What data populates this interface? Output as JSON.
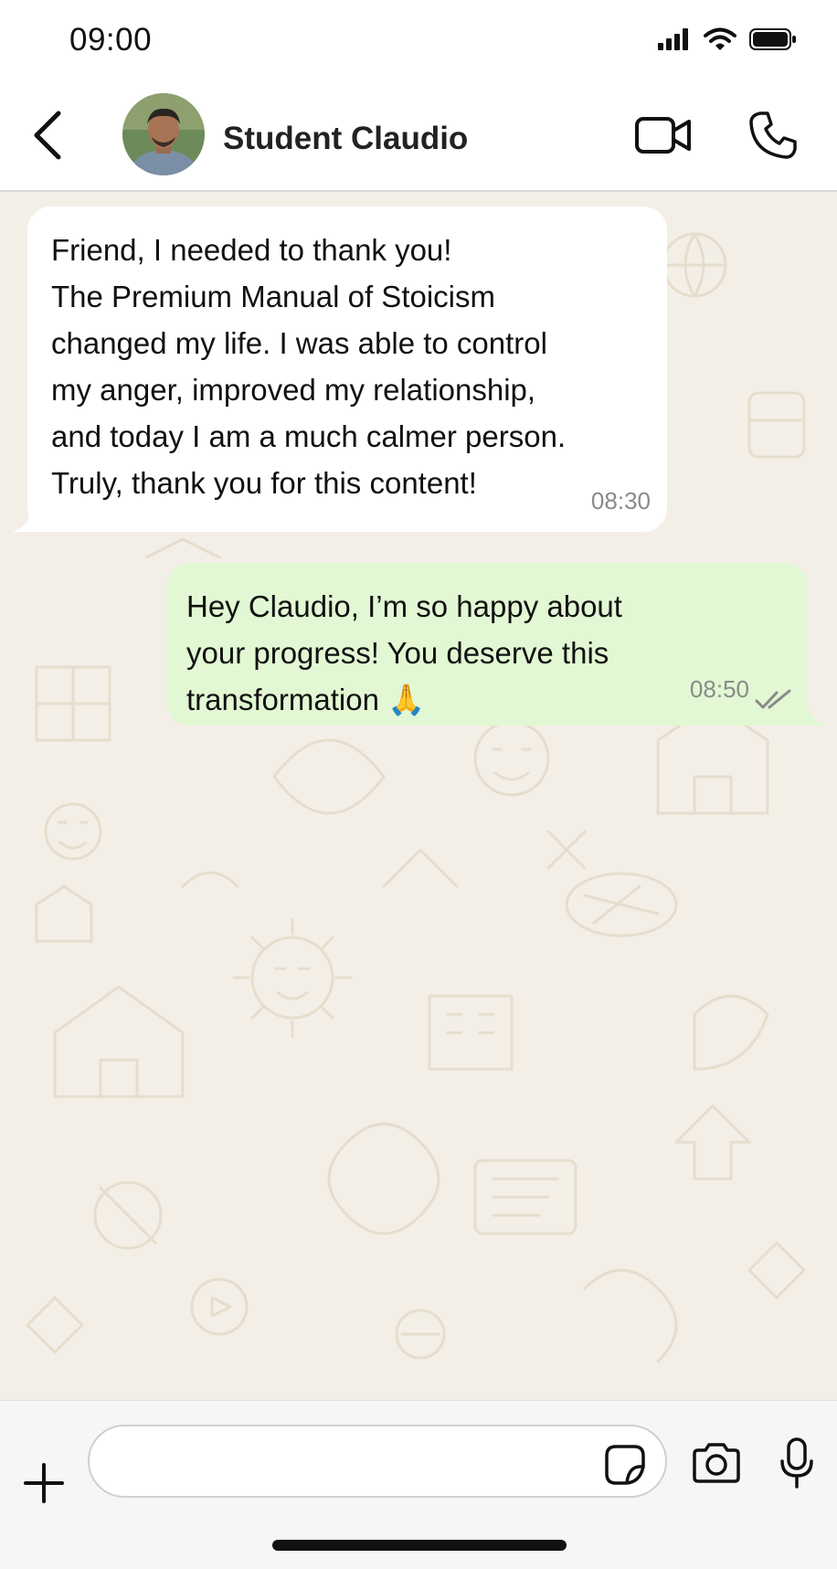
{
  "status_bar": {
    "time": "09:00",
    "icons": [
      "signal-icon",
      "wifi-icon",
      "battery-icon"
    ]
  },
  "header": {
    "contact_name": "Student Claudio",
    "icons": [
      "back-arrow-icon",
      "video-camera-icon",
      "phone-icon"
    ]
  },
  "messages": [
    {
      "direction": "incoming",
      "lines": [
        "Friend, I needed to thank you!",
        "The Premium Manual of Stoicism",
        "changed my life. I was able to control",
        "my anger, improved my relationship,",
        "and today I am a much calmer person.",
        "Truly, thank you for this content!"
      ],
      "time": "08:30"
    },
    {
      "direction": "outgoing",
      "lines": [
        "Hey Claudio, I’m so happy about",
        "your progress! You deserve this",
        "transformation"
      ],
      "emoji": "🙏",
      "time": "08:50",
      "status": "read"
    }
  ],
  "input_bar": {
    "message_value": "",
    "icons": [
      "plus-icon",
      "sticker-icon",
      "camera-icon",
      "microphone-icon"
    ]
  },
  "colors": {
    "chat_background": "#f3efe7",
    "incoming_bubble": "#ffffff",
    "outgoing_bubble": "#e2f8d4",
    "timestamp": "#8a8a8a",
    "read_ticks": "#8a8a8a"
  }
}
